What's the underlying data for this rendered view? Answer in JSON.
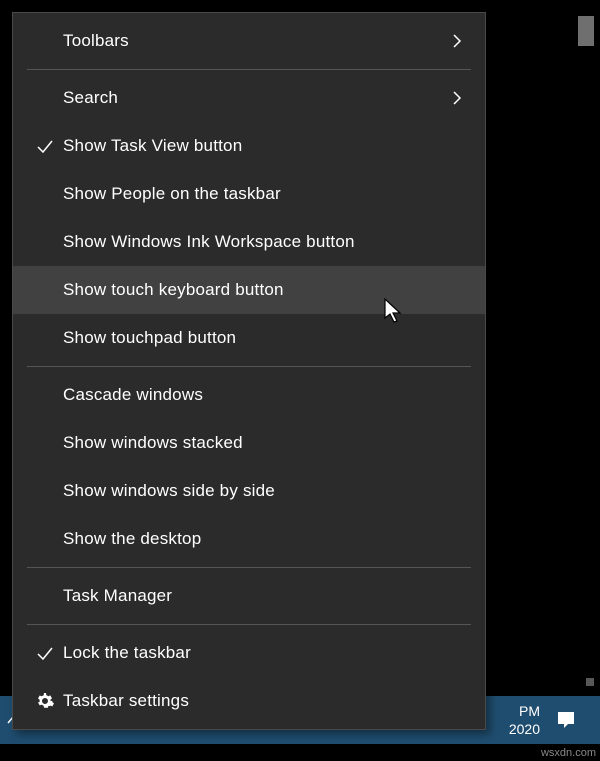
{
  "menu": {
    "toolbars": "Toolbars",
    "search": "Search",
    "show_task_view": "Show Task View button",
    "show_people": "Show People on the taskbar",
    "show_ink": "Show Windows Ink Workspace button",
    "show_touch_keyboard": "Show touch keyboard button",
    "show_touchpad": "Show touchpad button",
    "cascade": "Cascade windows",
    "stacked": "Show windows stacked",
    "side_by_side": "Show windows side by side",
    "show_desktop": "Show the desktop",
    "task_manager": "Task Manager",
    "lock_taskbar": "Lock the taskbar",
    "taskbar_settings": "Taskbar settings"
  },
  "clock": {
    "time": "PM",
    "date": "2020"
  },
  "watermark": "wsxdn.com"
}
